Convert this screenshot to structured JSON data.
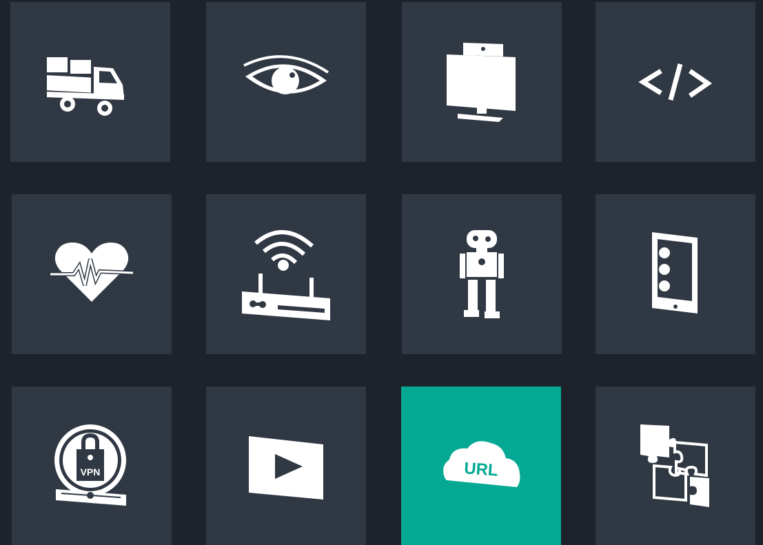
{
  "tiles": [
    {
      "name": "delivery-truck",
      "icon": "truck-icon"
    },
    {
      "name": "vision",
      "icon": "eye-icon"
    },
    {
      "name": "display",
      "icon": "monitor-icon"
    },
    {
      "name": "code",
      "icon": "code-icon",
      "glyph": "</>"
    },
    {
      "name": "health",
      "icon": "heartbeat-icon"
    },
    {
      "name": "wifi-router",
      "icon": "router-icon"
    },
    {
      "name": "robotics",
      "icon": "robot-icon"
    },
    {
      "name": "mobile",
      "icon": "tablet-icon"
    },
    {
      "name": "vpn",
      "icon": "vpn-lock-icon",
      "label": "VPN"
    },
    {
      "name": "video",
      "icon": "play-icon"
    },
    {
      "name": "url-cloud",
      "icon": "cloud-url-icon",
      "label": "URL",
      "active": true
    },
    {
      "name": "integration",
      "icon": "puzzle-icon"
    }
  ],
  "colors": {
    "background": "#1e232b",
    "tile": "#2f3843",
    "tile_active": "#04a893",
    "icon": "#ffffff"
  }
}
